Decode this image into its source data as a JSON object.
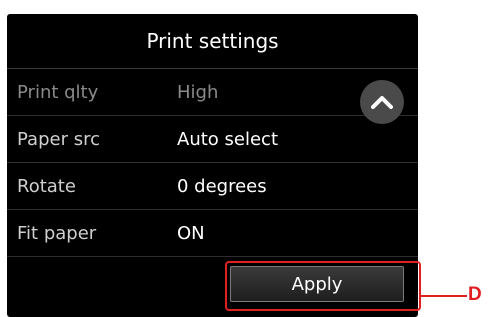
{
  "title": "Print settings",
  "settings": [
    {
      "label": "Print qlty",
      "value": "High"
    },
    {
      "label": "Paper src",
      "value": "Auto select"
    },
    {
      "label": "Rotate",
      "value": "0 degrees"
    },
    {
      "label": "Fit paper",
      "value": "ON"
    }
  ],
  "scroll": {
    "icon": "chevron-up-icon"
  },
  "apply_label": "Apply",
  "callout_label": "D",
  "colors": {
    "screen": "#000000",
    "highlight": "#e02020"
  }
}
